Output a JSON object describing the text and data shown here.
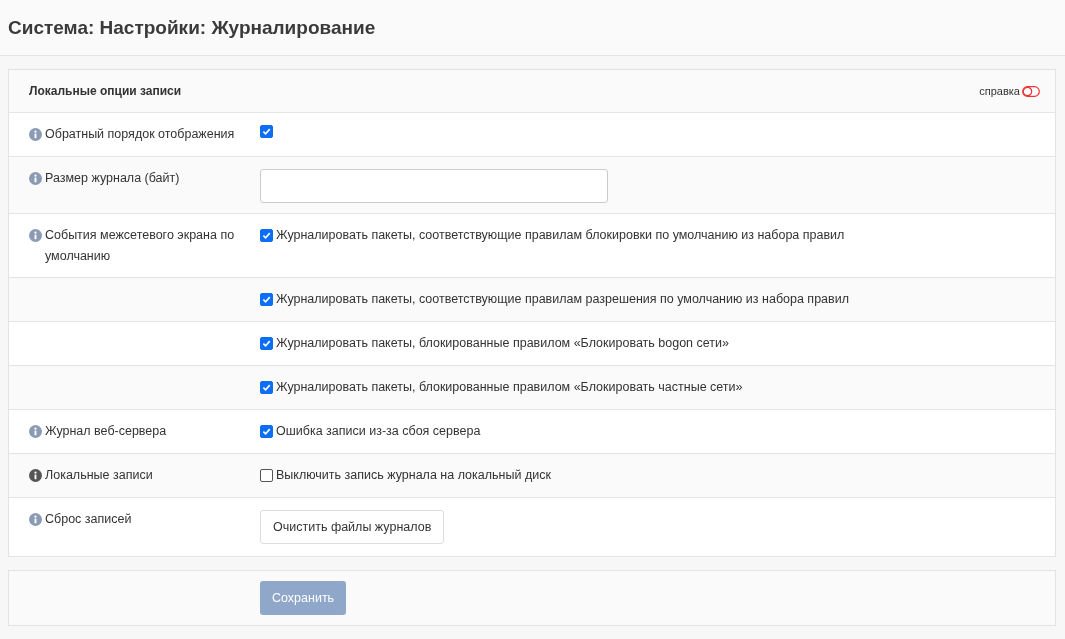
{
  "page_title": "Система: Настройки: Журналирование",
  "panel": {
    "title": "Локальные опции записи",
    "help": {
      "label": "справка",
      "on": false
    },
    "rows": [
      {
        "label": "Обратный порядок отображения",
        "info_hovered": false,
        "kind": "checkbox",
        "checked": true
      },
      {
        "label": "Размер журнала (байт)",
        "info_hovered": false,
        "kind": "text",
        "value": ""
      },
      {
        "label": "События межсетевого экрана по умолчанию",
        "info_hovered": false,
        "kind": "checkbox",
        "checked": true,
        "text": "Журналировать пакеты, соответствующие правилам блокировки по умолчанию из набора правил"
      },
      {
        "kind": "checkbox",
        "checked": true,
        "text": "Журналировать пакеты, соответствующие правилам разрешения по умолчанию из набора правил"
      },
      {
        "kind": "checkbox",
        "checked": true,
        "text": "Журналировать пакеты, блокированные правилом «Блокировать bogon сети»"
      },
      {
        "kind": "checkbox",
        "checked": true,
        "text": "Журналировать пакеты, блокированные правилом «Блокировать частные сети»"
      },
      {
        "label": "Журнал веб-сервера",
        "info_hovered": false,
        "kind": "checkbox",
        "checked": true,
        "text": "Ошибка записи из-за сбоя сервера"
      },
      {
        "label": "Локальные записи",
        "info_hovered": true,
        "kind": "checkbox",
        "checked": false,
        "text": "Выключить запись журнала на локальный диск"
      },
      {
        "label": "Сброс записей",
        "info_hovered": false,
        "kind": "button",
        "button": "Очистить файлы журналов"
      }
    ]
  },
  "save_button": {
    "label": "Сохранить",
    "disabled": true
  }
}
